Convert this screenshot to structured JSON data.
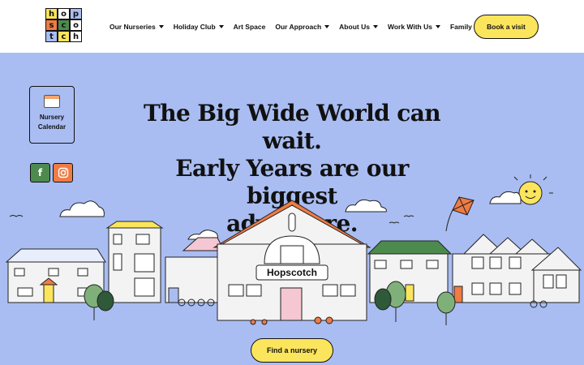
{
  "logo": {
    "letters": [
      "h",
      "o",
      "p",
      "s",
      "c",
      "o",
      "t",
      "c",
      "h"
    ]
  },
  "nav": {
    "items": [
      {
        "label": "Our Nurseries",
        "dropdown": true
      },
      {
        "label": "Holiday Club",
        "dropdown": true
      },
      {
        "label": "Art Space",
        "dropdown": false
      },
      {
        "label": "Our Approach",
        "dropdown": true
      },
      {
        "label": "About Us",
        "dropdown": true
      },
      {
        "label": "Work With Us",
        "dropdown": true
      },
      {
        "label": "Family Area",
        "dropdown": true
      }
    ],
    "cta": "Book a visit"
  },
  "sidebar": {
    "calendar_line1": "Nursery",
    "calendar_line2": "Calendar"
  },
  "hero": {
    "line1": "The Big Wide World can wait.",
    "line2": "Early Years are our biggest",
    "line3": "adventure."
  },
  "scene": {
    "building_sign": "Hopscotch"
  },
  "find_button": "Find a nursery",
  "colors": {
    "background": "#a9bdf2",
    "accent_yellow": "#fbe55c",
    "green": "#4d8a4e",
    "orange": "#ef7b45"
  }
}
